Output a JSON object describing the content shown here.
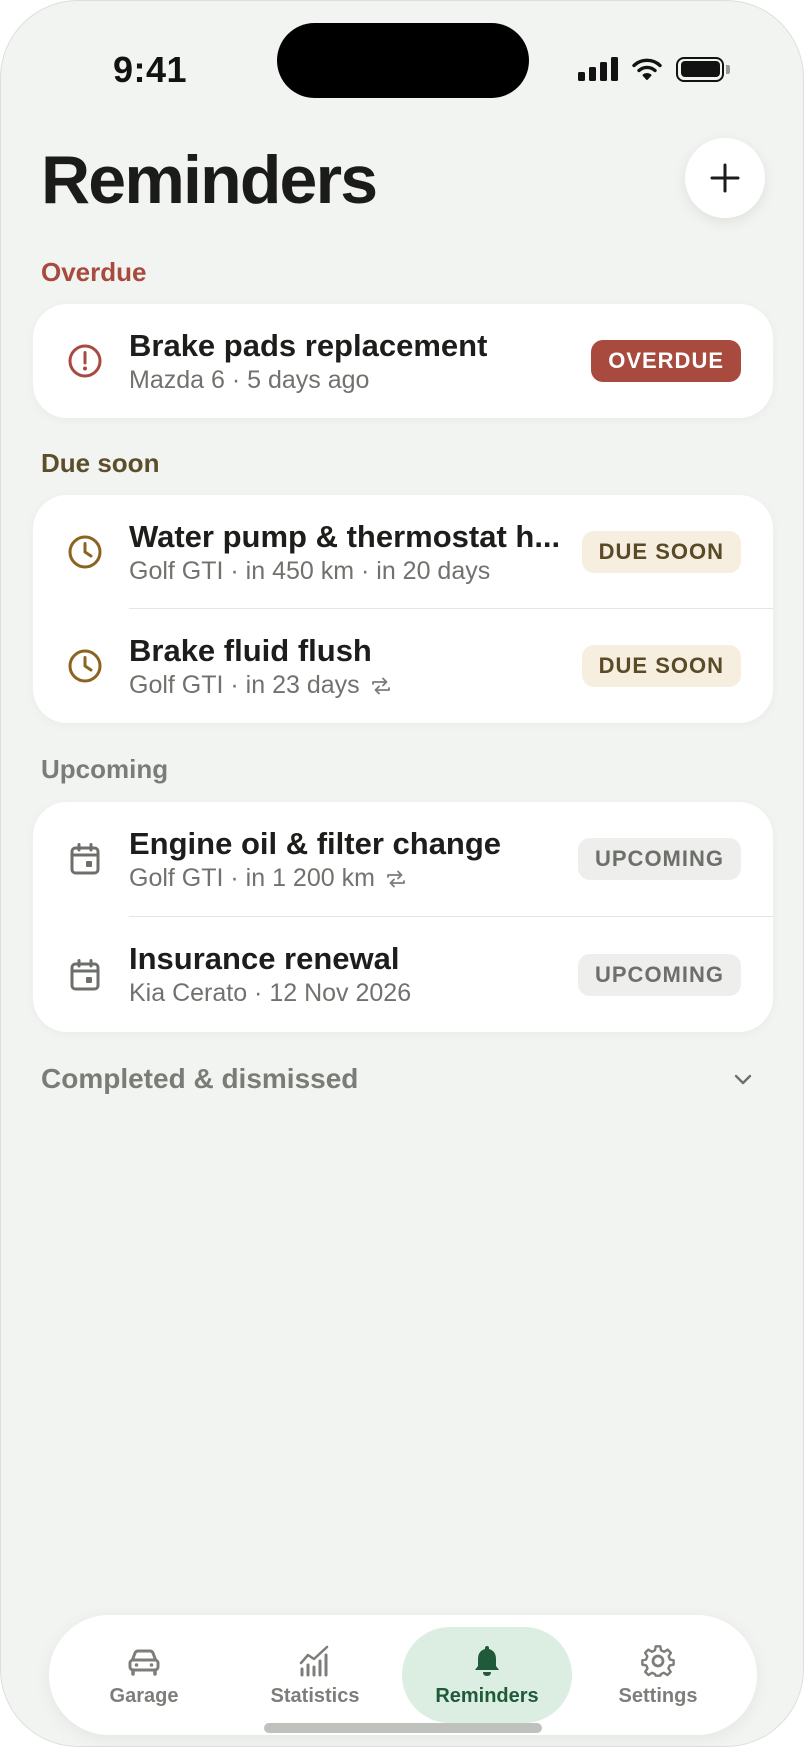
{
  "status_bar": {
    "time": "9:41"
  },
  "header": {
    "title": "Reminders",
    "add_label": "+"
  },
  "sections": {
    "overdue": {
      "label": "Overdue",
      "color": "#a84a3e",
      "items": [
        {
          "title": "Brake pads replacement",
          "subtitle": "Mazda 6 · 5 days ago",
          "badge": "OVERDUE",
          "repeats": false
        }
      ]
    },
    "due_soon": {
      "label": "Due soon",
      "color": "#5d4e2b",
      "items": [
        {
          "title": "Water pump & thermostat h...",
          "subtitle": "Golf GTI · in 450 km · in 20 days",
          "badge": "DUE SOON",
          "repeats": false
        },
        {
          "title": "Brake fluid flush",
          "subtitle": "Golf GTI · in 23 days",
          "badge": "DUE SOON",
          "repeats": true
        }
      ]
    },
    "upcoming": {
      "label": "Upcoming",
      "color": "#7a7d77",
      "items": [
        {
          "title": "Engine oil & filter change",
          "subtitle": "Golf GTI · in 1 200 km",
          "badge": "UPCOMING",
          "repeats": true
        },
        {
          "title": "Insurance renewal",
          "subtitle": "Kia Cerato · 12 Nov 2026",
          "badge": "UPCOMING",
          "repeats": false
        }
      ]
    },
    "completed": {
      "label": "Completed & dismissed"
    }
  },
  "icons": {
    "overdue": "alert-circle-icon",
    "due_soon": "clock-icon",
    "upcoming": "calendar-icon",
    "repeat": "repeat-icon"
  },
  "tabs": [
    {
      "label": "Garage",
      "icon": "car-icon",
      "active": false
    },
    {
      "label": "Statistics",
      "icon": "chart-icon",
      "active": false
    },
    {
      "label": "Reminders",
      "icon": "bell-icon",
      "active": true
    },
    {
      "label": "Settings",
      "icon": "gear-icon",
      "active": false
    }
  ],
  "colors": {
    "accent": "#1f5a3b",
    "active_tab_bg": "#dcede2",
    "background": "#f2f4f1"
  }
}
